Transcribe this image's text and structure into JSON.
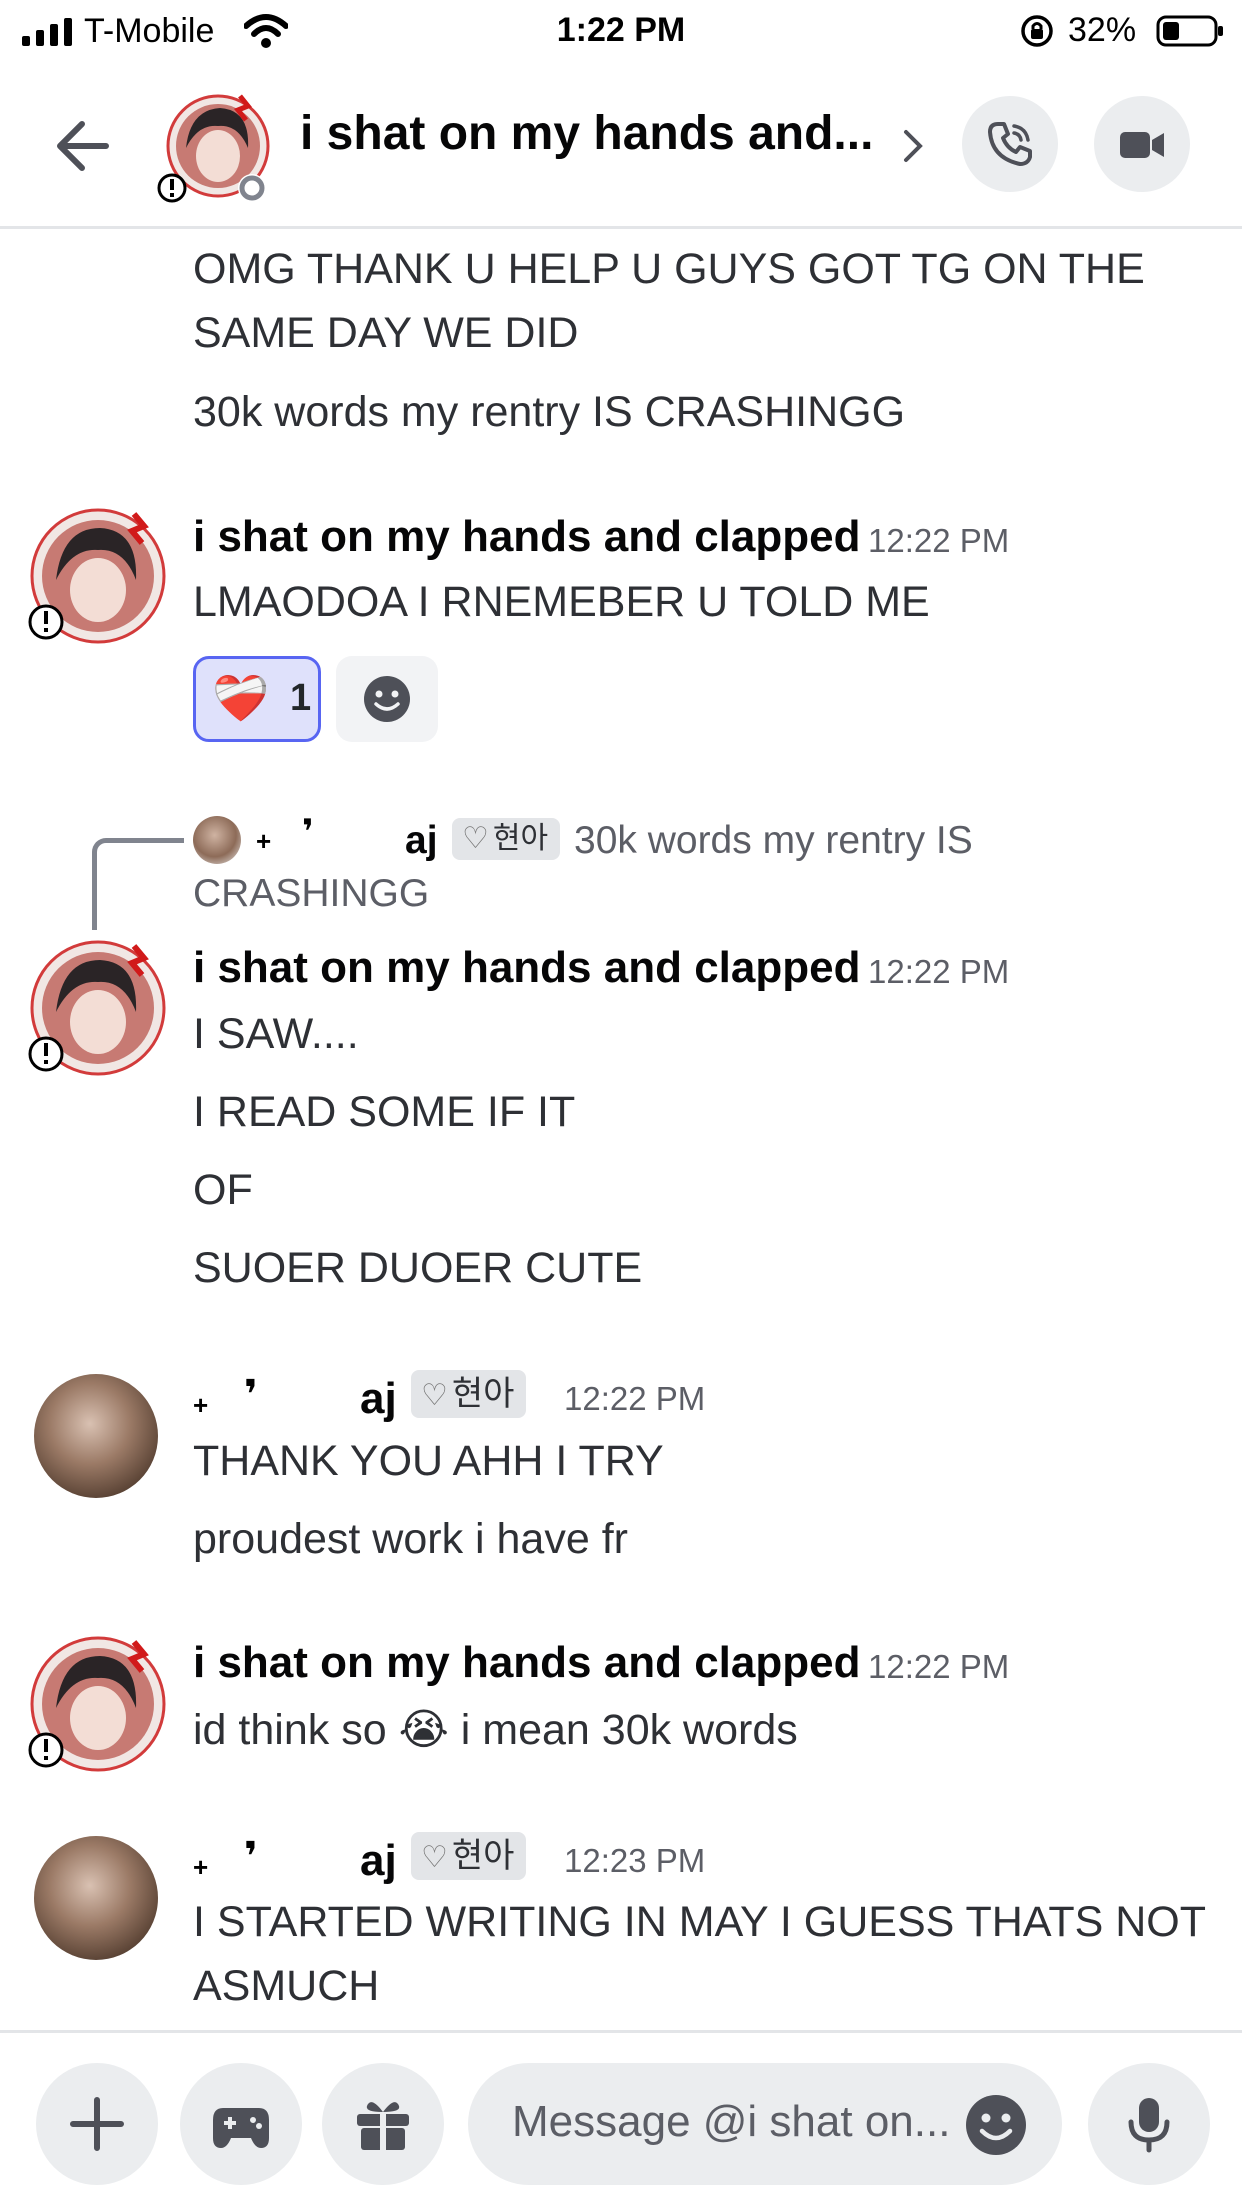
{
  "status_bar": {
    "carrier": "T-Mobile",
    "time": "1:22 PM",
    "battery": "32%"
  },
  "header": {
    "title": "i shat on my hands and...",
    "icons": [
      "back-arrow-icon",
      "chevron-right-icon",
      "phone-icon",
      "video-camera-icon"
    ]
  },
  "messages": {
    "m1": {
      "lines": [
        "OMG THANK U HELP U GUYS GOT TG ON THE",
        "SAME DAY WE DID",
        "30k words my rentry IS CRASHINGG"
      ]
    },
    "m2": {
      "author": "i shat on my hands and clapped",
      "time": "12:22 PM",
      "lines": [
        "LMAODOA I RNEMEBER U TOLD ME"
      ],
      "reaction_emoji": "❤️‍🩹",
      "reaction_count": "1"
    },
    "m3": {
      "reply_author": "aj",
      "reply_tag": "현아",
      "reply_text_1": "30k words my rentry IS",
      "reply_text_2": "CRASHINGG",
      "author": "i shat on my hands and clapped",
      "time": "12:22 PM",
      "lines": [
        "I SAW....",
        "I READ SOME IF IT",
        "OF",
        "SUOER DUOER CUTE"
      ]
    },
    "m4": {
      "author": "aj",
      "tag": "현아",
      "time": "12:22 PM",
      "lines": [
        "THANK YOU AHH I TRY",
        "proudest work i have fr"
      ]
    },
    "m5": {
      "author": "i shat on my hands and clapped",
      "time": "12:22 PM",
      "text_before": "id think so",
      "emoji": "😭",
      "text_after": "i mean 30k words"
    },
    "m6": {
      "author": "aj",
      "tag": "현아",
      "time": "12:23 PM",
      "lines": [
        "I STARTED WRITING IN MAY I GUESS THATS NOT",
        "ASMUCH"
      ]
    }
  },
  "composer": {
    "placeholder": "Message @i shat on...",
    "icons": [
      "plus-icon",
      "gamepad-icon",
      "gift-icon",
      "emoji-icon",
      "microphone-icon"
    ]
  },
  "colors": {
    "accent": "#5865f2",
    "reaction_bg": "#dfe1fb",
    "button_bg": "#ebedef",
    "text": "#2e3035"
  }
}
